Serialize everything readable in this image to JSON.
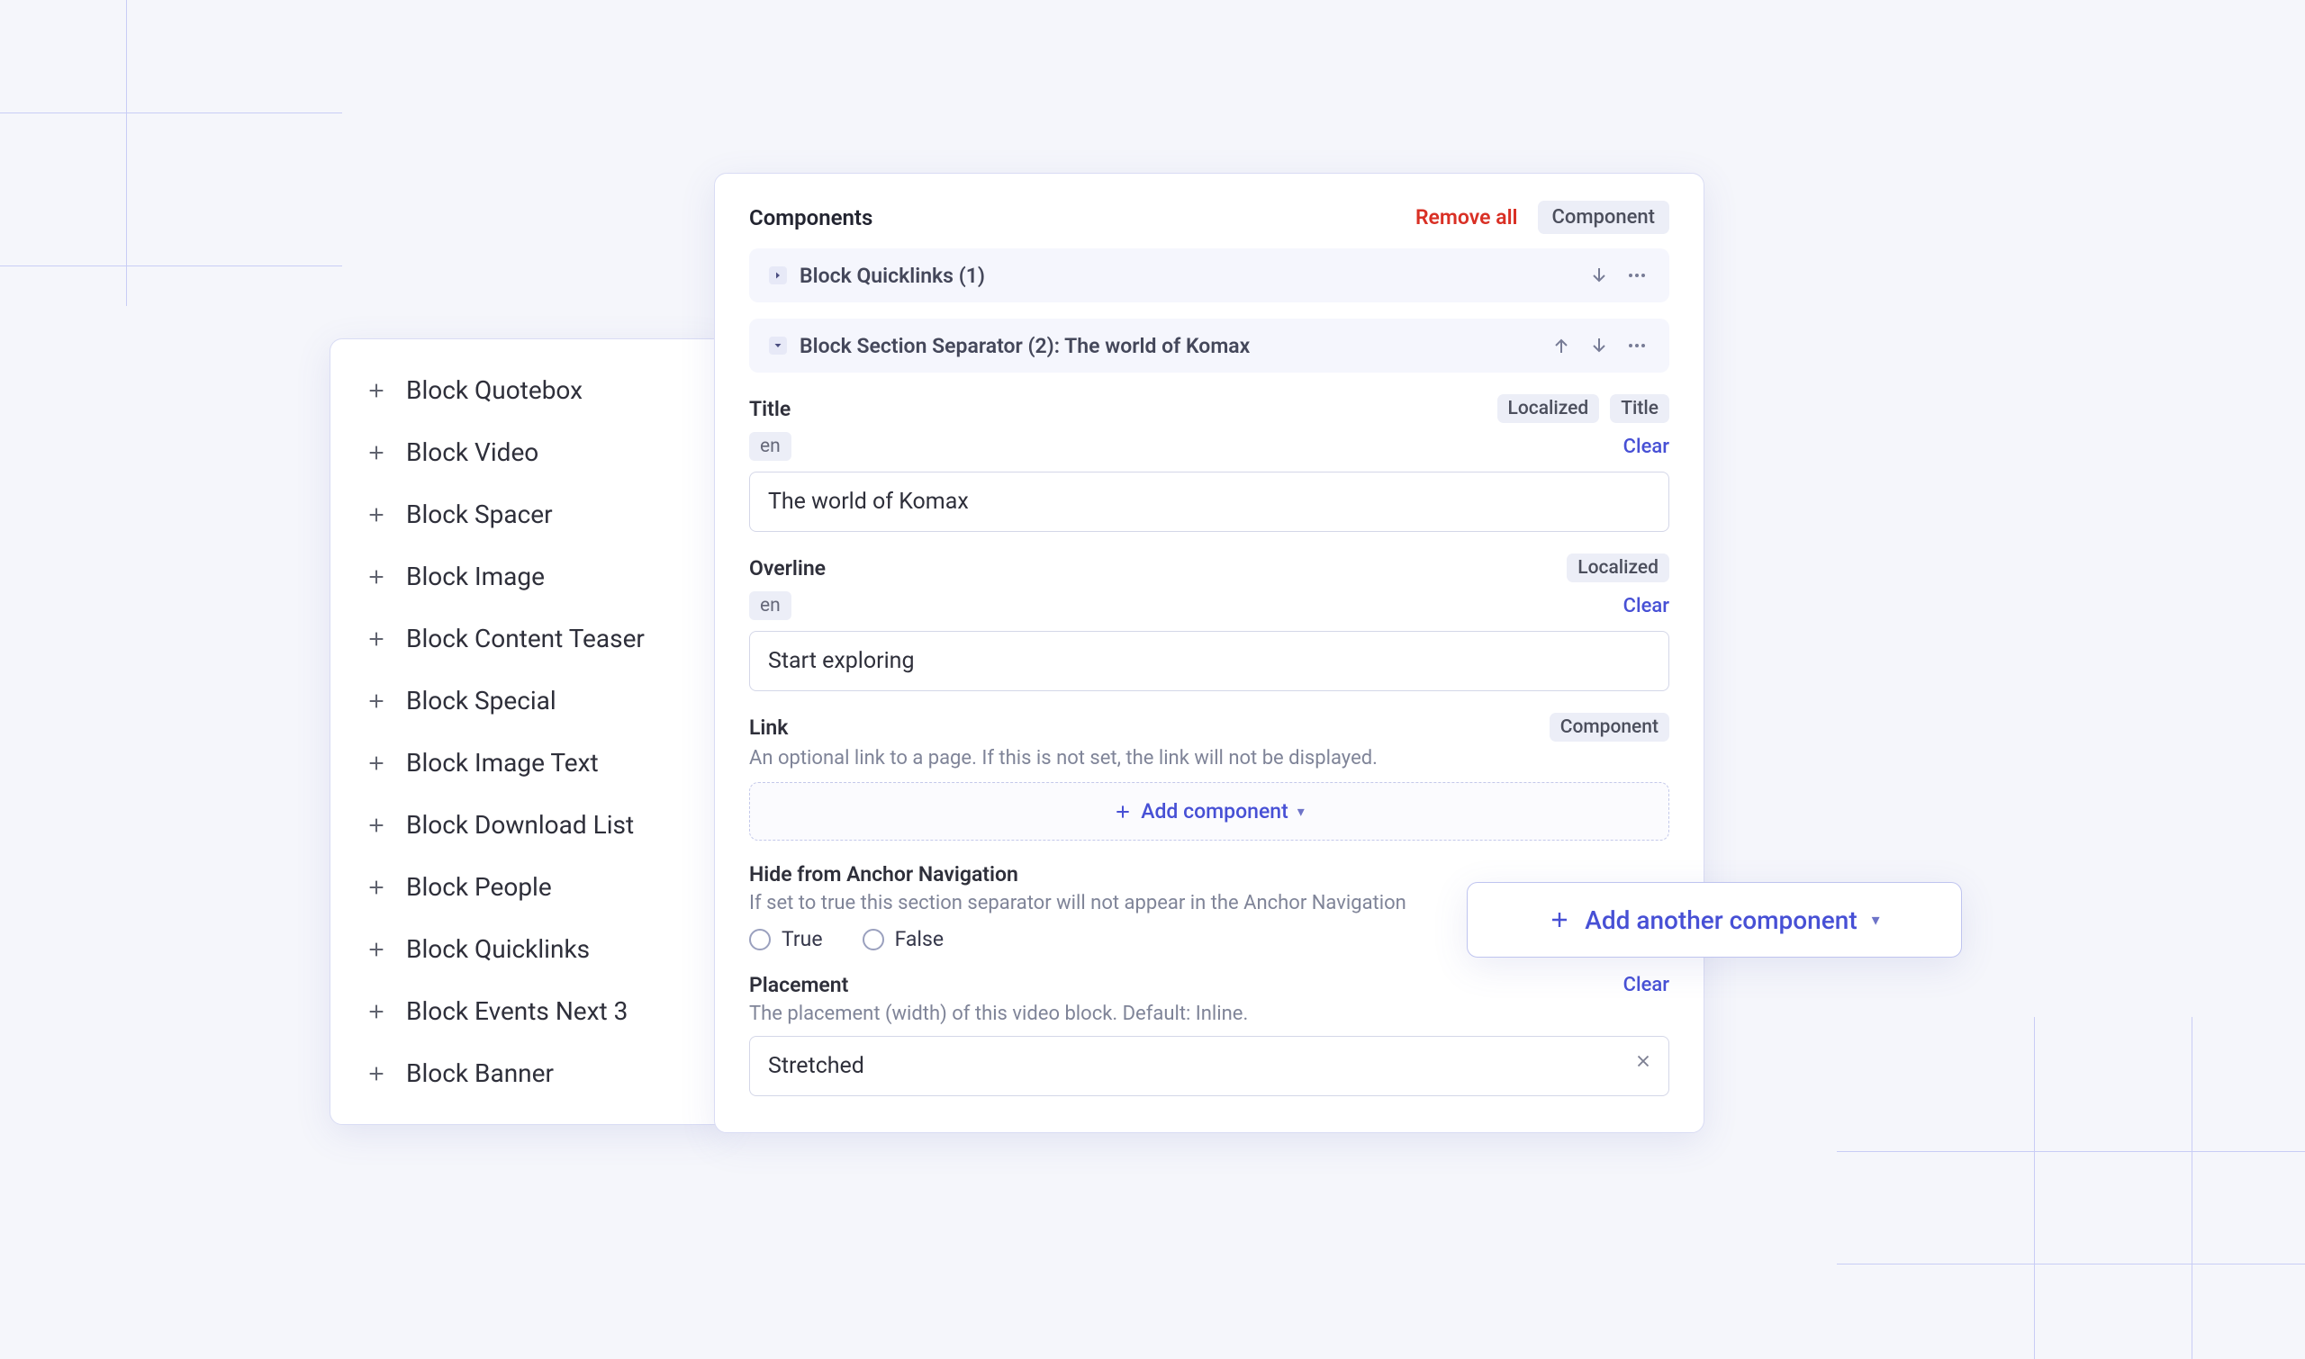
{
  "block_types": [
    "Block Quotebox",
    "Block Video",
    "Block Spacer",
    "Block Image",
    "Block Content Teaser",
    "Block Special",
    "Block Image Text",
    "Block Download List",
    "Block People",
    "Block Quicklinks",
    "Block Events Next 3",
    "Block Banner"
  ],
  "editor": {
    "header": {
      "title": "Components",
      "remove_all": "Remove all",
      "component_pill": "Component"
    },
    "slots": [
      {
        "name": "Block Quicklinks (1)"
      },
      {
        "name": "Block Section Separator (2): The world of Komax"
      }
    ],
    "fields": {
      "title": {
        "label": "Title",
        "localized_pill": "Localized",
        "type_pill": "Title",
        "locale": "en",
        "clear": "Clear",
        "value": "The world of Komax"
      },
      "overline": {
        "label": "Overline",
        "localized_pill": "Localized",
        "locale": "en",
        "clear": "Clear",
        "value": "Start exploring"
      },
      "link": {
        "label": "Link",
        "component_pill": "Component",
        "help": "An optional link to a page. If this is not set, the link will not be displayed.",
        "add_label": "Add component"
      },
      "hide": {
        "label": "Hide from Anchor Navigation",
        "help": "If set to true this section separator will not appear in the Anchor Navigation",
        "true_label": "True",
        "false_label": "False"
      },
      "placement": {
        "label": "Placement",
        "clear": "Clear",
        "help": "The placement (width) of this video block. Default: Inline.",
        "value": "Stretched"
      }
    }
  },
  "add_another_label": "Add another component"
}
